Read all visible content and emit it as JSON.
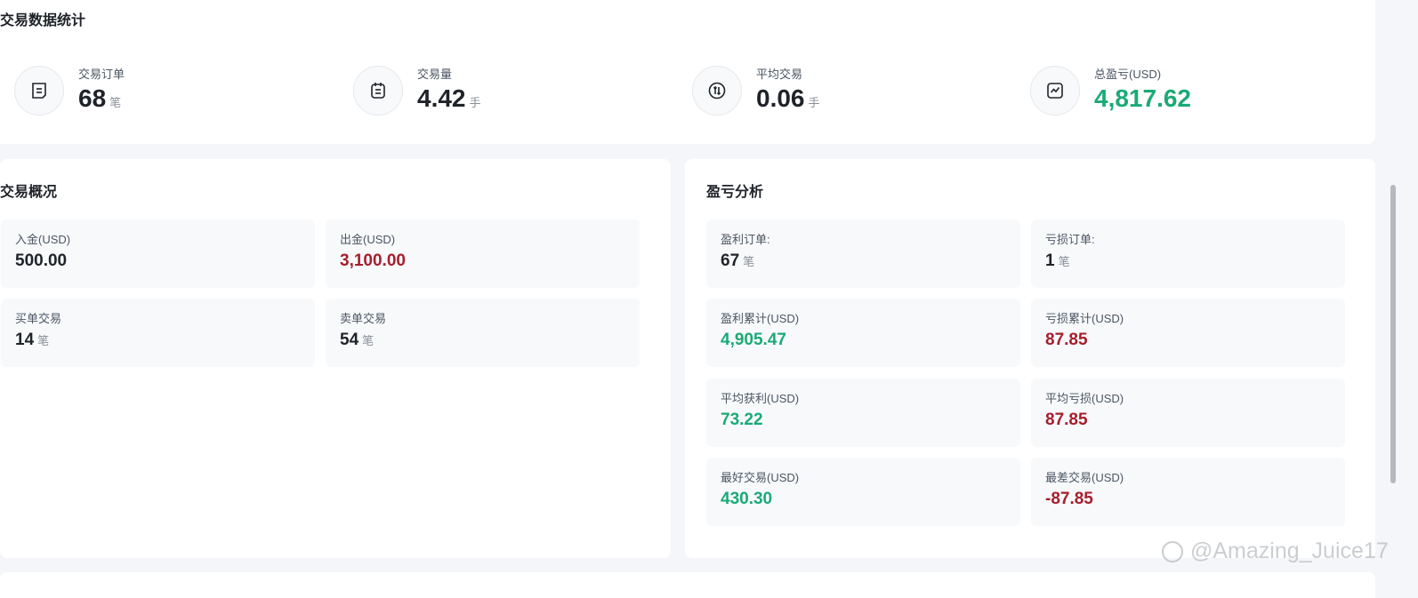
{
  "top": {
    "title": "交易数据统计",
    "stats": [
      {
        "label": "交易订单",
        "value": "68",
        "unit": "笔",
        "icon": "list-icon"
      },
      {
        "label": "交易量",
        "value": "4.42",
        "unit": "手",
        "icon": "calendar-list-icon"
      },
      {
        "label": "平均交易",
        "value": "0.06",
        "unit": "手",
        "icon": "swap-arrows-icon"
      },
      {
        "label": "总盈亏(USD)",
        "value": "4,817.62",
        "unit": "",
        "icon": "trend-chart-icon",
        "color": "#1aaa76"
      }
    ]
  },
  "overview": {
    "title": "交易概况",
    "cards": [
      {
        "label": "入金(USD)",
        "value": "500.00",
        "unit": ""
      },
      {
        "label": "出金(USD)",
        "value": "3,100.00",
        "unit": "",
        "color": "#a61e2c"
      },
      {
        "label": "买单交易",
        "value": "14",
        "unit": "笔"
      },
      {
        "label": "卖单交易",
        "value": "54",
        "unit": "笔"
      }
    ]
  },
  "pnl": {
    "title": "盈亏分析",
    "cards": [
      {
        "label": "盈利订单:",
        "value": "67",
        "unit": "笔"
      },
      {
        "label": "亏损订单:",
        "value": "1",
        "unit": "笔"
      },
      {
        "label": "盈利累计(USD)",
        "value": "4,905.47",
        "unit": "",
        "color": "#1aaa76"
      },
      {
        "label": "亏损累计(USD)",
        "value": "87.85",
        "unit": "",
        "color": "#a61e2c"
      },
      {
        "label": "平均获利(USD)",
        "value": "73.22",
        "unit": "",
        "color": "#1aaa76"
      },
      {
        "label": "平均亏损(USD)",
        "value": "87.85",
        "unit": "",
        "color": "#a61e2c"
      },
      {
        "label": "最好交易(USD)",
        "value": "430.30",
        "unit": "",
        "color": "#1aaa76"
      },
      {
        "label": "最差交易(USD)",
        "value": "-87.85",
        "unit": "",
        "color": "#a61e2c"
      }
    ]
  },
  "watermark": {
    "text": "@Amazing_Juice17"
  }
}
